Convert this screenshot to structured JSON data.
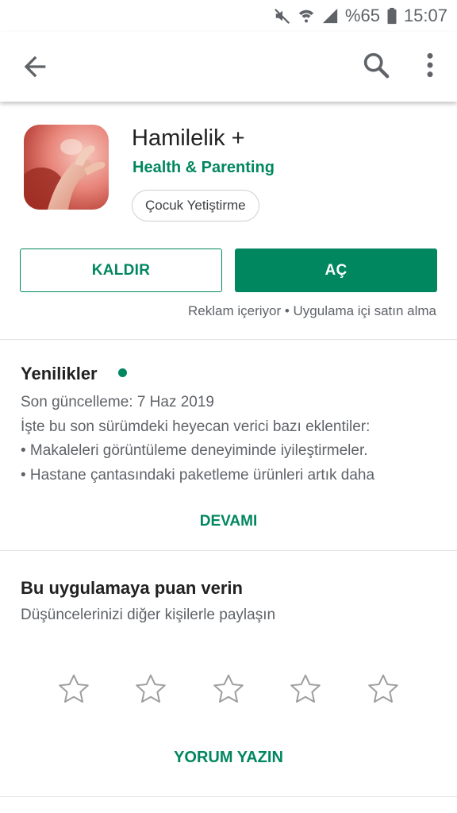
{
  "status_bar": {
    "battery": "%65",
    "time": "15:07",
    "icons": [
      "mute-icon",
      "wifi-icon",
      "signal-icon",
      "battery-icon"
    ]
  },
  "toolbar": {
    "icons": [
      "back-arrow-icon",
      "search-icon",
      "more-vert-icon"
    ]
  },
  "app": {
    "title": "Hamilelik +",
    "developer": "Health & Parenting",
    "category_chip": "Çocuk Yetiştirme",
    "uninstall_label": "KALDIR",
    "open_label": "AÇ",
    "disclaimer": "Reklam içeriyor • Uygulama içi satın alma"
  },
  "whats_new": {
    "title": "Yenilikler",
    "lines": [
      "Son güncelleme: 7 Haz 2019",
      "İşte bu son sürümdeki heyecan verici bazı eklentiler:",
      "• Makaleleri görüntüleme deneyiminde iyileştirmeler.",
      "• Hastane çantasındaki paketleme ürünleri artık daha"
    ],
    "more_label": "DEVAMI"
  },
  "rating": {
    "title": "Bu uygulamaya puan verin",
    "subtitle": "Düşüncelerinizi diğer kişilerle paylaşın",
    "stars_total": 5,
    "stars_selected": 0,
    "write_label": "YORUM YAZIN"
  },
  "colors": {
    "accent": "#01875f",
    "text_primary": "#212121",
    "text_secondary": "#5f6368"
  }
}
